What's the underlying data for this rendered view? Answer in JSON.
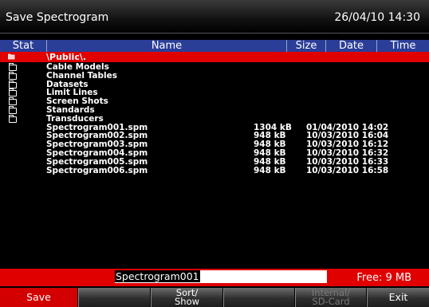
{
  "window": {
    "title": "Save Spectrogram",
    "datetime": "26/04/10 14:30"
  },
  "columns": {
    "stat": "Stat",
    "name": "Name",
    "size": "Size",
    "date": "Date",
    "time": "Time"
  },
  "path": "\\Public\\.",
  "files": [
    {
      "name": "Cable Models",
      "type": "folder",
      "size": "",
      "date": ""
    },
    {
      "name": "Channel Tables",
      "type": "folder",
      "size": "",
      "date": ""
    },
    {
      "name": "Datasets",
      "type": "folder",
      "size": "",
      "date": ""
    },
    {
      "name": "Limit Lines",
      "type": "folder",
      "size": "",
      "date": ""
    },
    {
      "name": "Screen Shots",
      "type": "folder",
      "size": "",
      "date": ""
    },
    {
      "name": "Standards",
      "type": "folder",
      "size": "",
      "date": ""
    },
    {
      "name": "Transducers",
      "type": "folder",
      "size": "",
      "date": ""
    },
    {
      "name": "Spectrogram001.spm",
      "type": "file",
      "size": "1304 kB",
      "date": "01/04/2010 14:02"
    },
    {
      "name": "Spectrogram002.spm",
      "type": "file",
      "size": "948 kB",
      "date": "10/03/2010 16:04"
    },
    {
      "name": "Spectrogram003.spm",
      "type": "file",
      "size": "948 kB",
      "date": "10/03/2010 16:12"
    },
    {
      "name": "Spectrogram004.spm",
      "type": "file",
      "size": "948 kB",
      "date": "10/03/2010 16:32"
    },
    {
      "name": "Spectrogram005.spm",
      "type": "file",
      "size": "948 kB",
      "date": "10/03/2010 16:33"
    },
    {
      "name": "Spectrogram006.spm",
      "type": "file",
      "size": "948 kB",
      "date": "10/03/2010 16:58"
    }
  ],
  "filename": {
    "value": "Spectrogram001"
  },
  "free_space": "Free: 9 MB",
  "softkeys": {
    "save": "Save",
    "key2": "",
    "sort_line1": "Sort/",
    "sort_line2": "Show",
    "key4": "",
    "storage_line1": "Internal/",
    "storage_line2": "SD-Card",
    "exit": "Exit"
  },
  "colors": {
    "header_blue": "#2a3e98",
    "accent_red": "#e00000"
  },
  "icons": {
    "folder": "folder-icon",
    "open_folder": "open-folder-icon"
  }
}
